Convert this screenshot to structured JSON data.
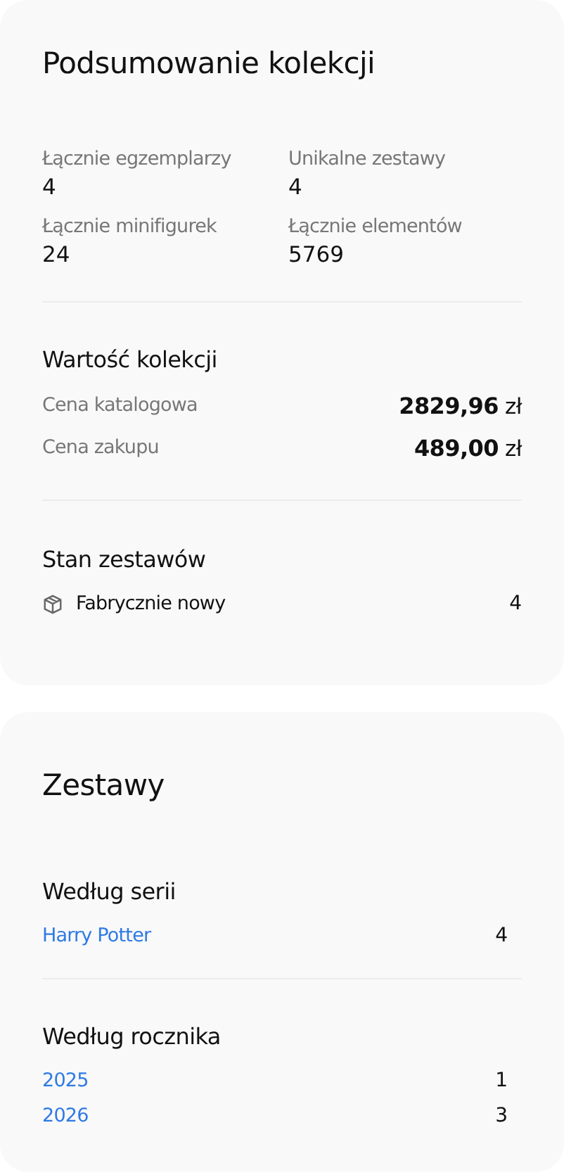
{
  "summary": {
    "title": "Podsumowanie kolekcji",
    "stats": [
      {
        "label": "Łącznie egzemplarzy",
        "value": "4"
      },
      {
        "label": "Unikalne zestawy",
        "value": "4"
      },
      {
        "label": "Łącznie minifigurek",
        "value": "24"
      },
      {
        "label": "Łącznie elementów",
        "value": "5769"
      }
    ],
    "value_section": {
      "title": "Wartość kolekcji",
      "rows": [
        {
          "label": "Cena katalogowa",
          "amount": "2829,96",
          "currency": "zł"
        },
        {
          "label": "Cena zakupu",
          "amount": "489,00",
          "currency": "zł"
        }
      ]
    },
    "condition_section": {
      "title": "Stan zestawów",
      "rows": [
        {
          "label": "Fabrycznie nowy",
          "count": "4"
        }
      ]
    }
  },
  "sets": {
    "title": "Zestawy",
    "groups": [
      {
        "title": "Według serii",
        "items": [
          {
            "label": "Harry Potter",
            "count": "4"
          }
        ]
      },
      {
        "title": "Według rocznika",
        "items": [
          {
            "label": "2025",
            "count": "1"
          },
          {
            "label": "2026",
            "count": "3"
          }
        ]
      }
    ]
  }
}
